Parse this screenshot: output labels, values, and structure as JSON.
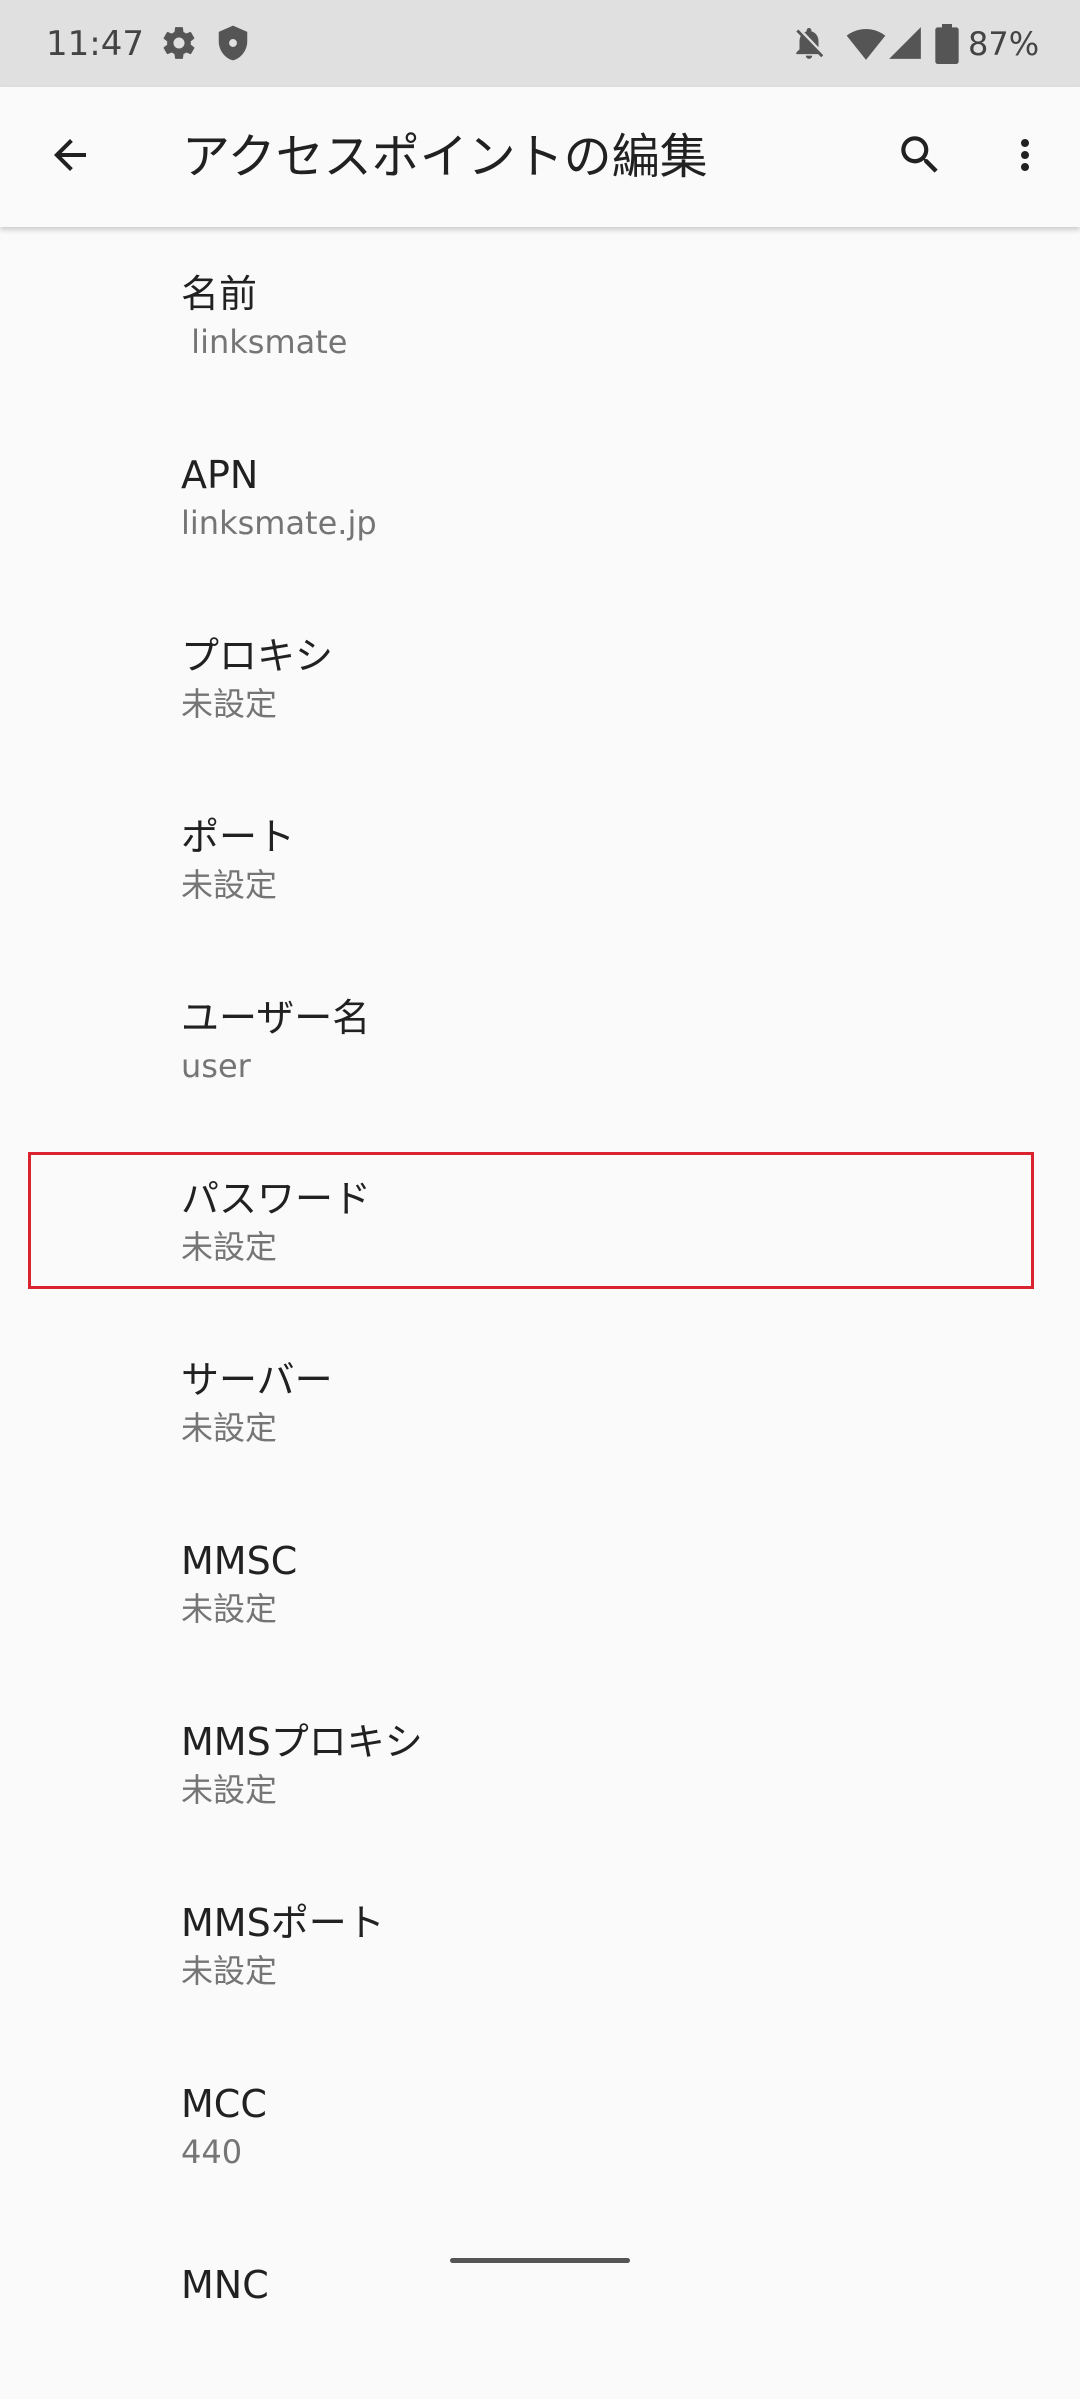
{
  "status_bar": {
    "time": "11:47",
    "battery": "87%",
    "icons": [
      "gear-icon",
      "shield-icon",
      "notifications-off-icon",
      "wifi-icon",
      "signal-icon",
      "battery-icon"
    ]
  },
  "app_bar": {
    "title": "アクセスポイントの編集",
    "back_icon": "arrow-back-icon",
    "search_icon": "search-icon",
    "more_icon": "more-vert-icon"
  },
  "items": [
    {
      "title": "名前",
      "summary": " linksmate"
    },
    {
      "title": "APN",
      "summary": "linksmate.jp"
    },
    {
      "title": "プロキシ",
      "summary": "未設定"
    },
    {
      "title": "ポート",
      "summary": "未設定"
    },
    {
      "title": "ユーザー名",
      "summary": "user"
    },
    {
      "title": "パスワード",
      "summary": "未設定"
    },
    {
      "title": "サーバー",
      "summary": "未設定"
    },
    {
      "title": "MMSC",
      "summary": "未設定"
    },
    {
      "title": "MMSプロキシ",
      "summary": "未設定"
    },
    {
      "title": "MMSポート",
      "summary": "未設定"
    },
    {
      "title": "MCC",
      "summary": "440"
    },
    {
      "title": "MNC",
      "summary": ""
    }
  ],
  "colors": {
    "highlight": "#d9232e",
    "background": "#fafafa",
    "status_bar": "#e0e0e0"
  }
}
